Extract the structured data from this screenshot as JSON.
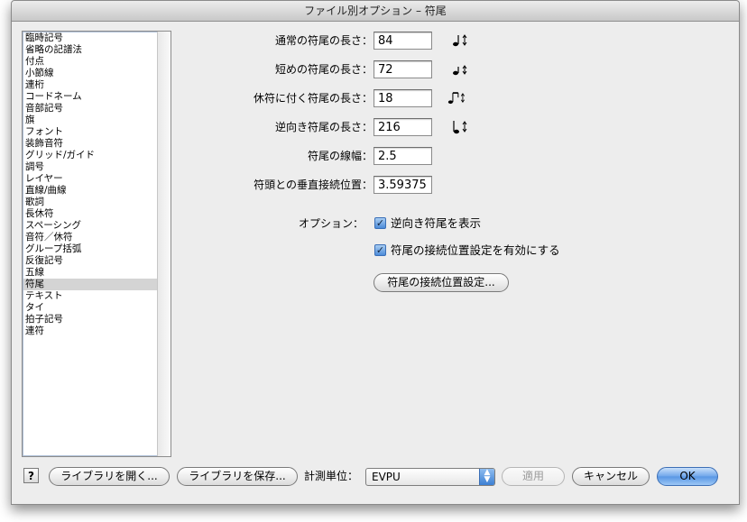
{
  "window": {
    "title": "ファイル別オプション – 符尾"
  },
  "categories": [
    {
      "label": "臨時記号",
      "selected": false
    },
    {
      "label": "省略の記譜法",
      "selected": false
    },
    {
      "label": "付点",
      "selected": false
    },
    {
      "label": "小節線",
      "selected": false
    },
    {
      "label": "連桁",
      "selected": false
    },
    {
      "label": "コードネーム",
      "selected": false
    },
    {
      "label": "音部記号",
      "selected": false
    },
    {
      "label": "旗",
      "selected": false
    },
    {
      "label": "フォント",
      "selected": false
    },
    {
      "label": "装飾音符",
      "selected": false
    },
    {
      "label": "グリッド/ガイド",
      "selected": false
    },
    {
      "label": "調号",
      "selected": false
    },
    {
      "label": "レイヤー",
      "selected": false
    },
    {
      "label": "直線/曲線",
      "selected": false
    },
    {
      "label": "歌詞",
      "selected": false
    },
    {
      "label": "長休符",
      "selected": false
    },
    {
      "label": "スペーシング",
      "selected": false
    },
    {
      "label": "音符／休符",
      "selected": false
    },
    {
      "label": "グループ括弧",
      "selected": false
    },
    {
      "label": "反復記号",
      "selected": false
    },
    {
      "label": "五線",
      "selected": false
    },
    {
      "label": "符尾",
      "selected": true
    },
    {
      "label": "テキスト",
      "selected": false
    },
    {
      "label": "タイ",
      "selected": false
    },
    {
      "label": "拍子記号",
      "selected": false
    },
    {
      "label": "連符",
      "selected": false
    }
  ],
  "settings": {
    "normal_stem": {
      "label": "通常の符尾の長さ：",
      "value": "84",
      "icon": "stem-length-icon"
    },
    "short_stem": {
      "label": "短めの符尾の長さ：",
      "value": "72",
      "icon": "short-stem-icon"
    },
    "rest_stem": {
      "label": "休符に付く符尾の長さ：",
      "value": "18",
      "icon": "beamed-rest-stem-icon"
    },
    "reverse_stem": {
      "label": "逆向き符尾の長さ：",
      "value": "216",
      "icon": "reverse-stem-icon"
    },
    "stem_width": {
      "label": "符尾の線幅：",
      "value": "2.5"
    },
    "vertical_attach": {
      "label": "符頭との垂直接続位置：",
      "value": "3.59375"
    }
  },
  "options": {
    "label": "オプション：",
    "show_reverse": {
      "label": "逆向き符尾を表示",
      "checked": true
    },
    "enable_connection": {
      "label": "符尾の接続位置設定を有効にする",
      "checked": true
    },
    "connection_button": "符尾の接続位置設定..."
  },
  "footer": {
    "help": "?",
    "open_library": "ライブラリを開く...",
    "save_library": "ライブラリを保存...",
    "units_label": "計測単位：",
    "units_value": "EVPU",
    "apply": "適用",
    "cancel": "キャンセル",
    "ok": "OK"
  },
  "colors": {
    "accent": "#5896e4",
    "selection": "#d4d4d4",
    "window_bg": "#ededed"
  }
}
